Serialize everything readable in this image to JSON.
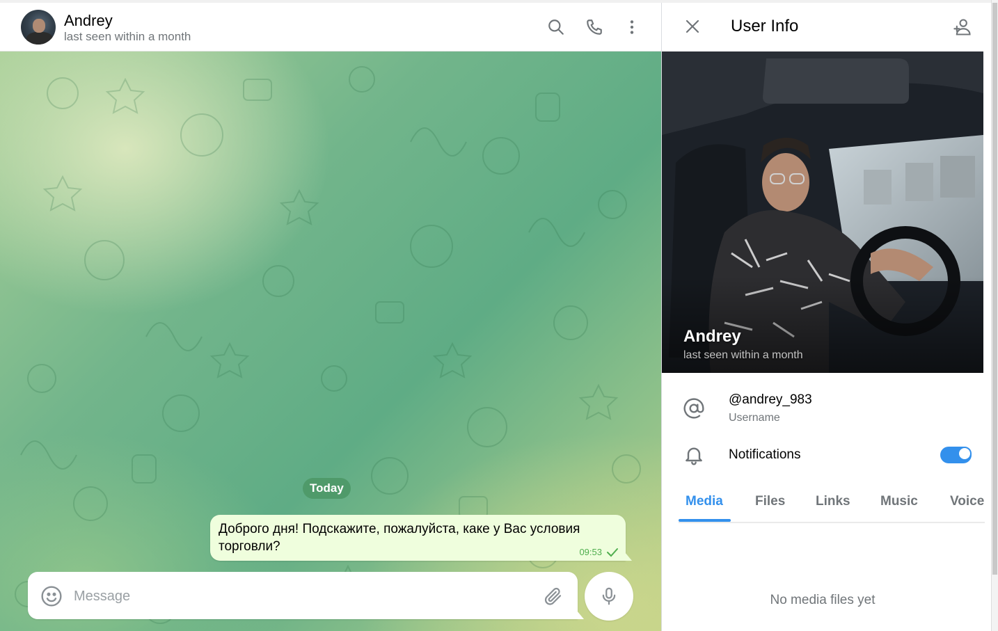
{
  "chat": {
    "peer_name": "Andrey",
    "peer_status": "last seen within a month",
    "date_separator": "Today",
    "messages": [
      {
        "text": "Доброго дня! Подскажите, пожалуйста, каке у Вас условия торговли?",
        "time": "09:53",
        "status": "sent-check-icon"
      }
    ],
    "composer": {
      "placeholder": "Message"
    },
    "header_icons": [
      "search-icon",
      "phone-icon",
      "more-vertical-icon"
    ]
  },
  "panel": {
    "title": "User Info",
    "name": "Andrey",
    "status": "last seen within a month",
    "username": "@andrey_983",
    "username_label": "Username",
    "notifications_label": "Notifications",
    "notifications_on": true,
    "tabs": [
      {
        "label": "Media",
        "active": true
      },
      {
        "label": "Files",
        "active": false
      },
      {
        "label": "Links",
        "active": false
      },
      {
        "label": "Music",
        "active": false
      },
      {
        "label": "Voice",
        "active": false
      }
    ],
    "empty_text": "No media files yet"
  },
  "colors": {
    "accent": "#3390ec",
    "outgoing_bubble": "#effedd",
    "read_check": "#4fae4e",
    "date_pill": "#4f9a6a"
  }
}
